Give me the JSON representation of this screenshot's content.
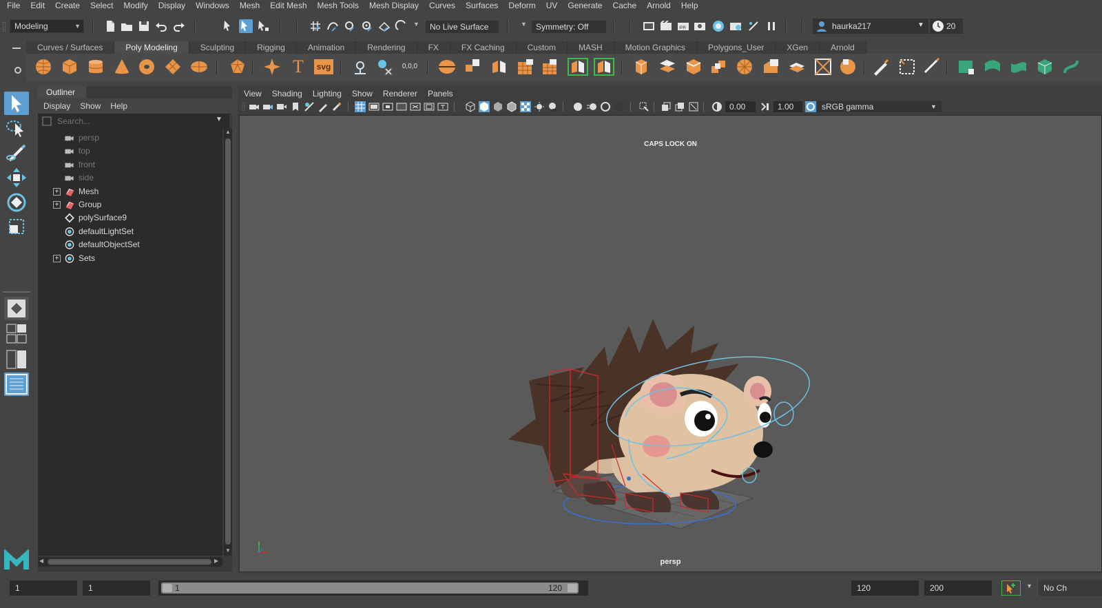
{
  "menubar": [
    "File",
    "Edit",
    "Create",
    "Select",
    "Modify",
    "Display",
    "Windows",
    "Mesh",
    "Edit Mesh",
    "Mesh Tools",
    "Mesh Display",
    "Curves",
    "Surfaces",
    "Deform",
    "UV",
    "Generate",
    "Cache",
    "Arnold",
    "Help"
  ],
  "status": {
    "menuset": "Modeling",
    "live_surface": "No Live Surface",
    "symmetry": "Symmetry: Off",
    "user": "haurka217",
    "clock_value": "20"
  },
  "shelf": {
    "tabs": [
      "Curves / Surfaces",
      "Poly Modeling",
      "Sculpting",
      "Rigging",
      "Animation",
      "Rendering",
      "FX",
      "FX Caching",
      "Custom",
      "MASH",
      "Motion Graphics",
      "Polygons_User",
      "XGen",
      "Arnold"
    ],
    "active_tab": "Poly Modeling",
    "svg_label": "svg",
    "text_label": "T",
    "snow_label": "0,0,0"
  },
  "outliner": {
    "title": "Outliner",
    "menu": [
      "Display",
      "Show",
      "Help"
    ],
    "search_placeholder": "Search...",
    "items": [
      {
        "label": "persp",
        "icon": "camera-icon",
        "expandable": false,
        "dim": true
      },
      {
        "label": "top",
        "icon": "camera-icon",
        "expandable": false,
        "dim": true
      },
      {
        "label": "front",
        "icon": "camera-icon",
        "expandable": false,
        "dim": true
      },
      {
        "label": "side",
        "icon": "camera-icon",
        "expandable": false,
        "dim": true
      },
      {
        "label": "Mesh",
        "icon": "transform-group-icon",
        "expandable": true,
        "dim": false
      },
      {
        "label": "Group",
        "icon": "transform-group-icon",
        "expandable": true,
        "dim": false
      },
      {
        "label": "polySurface9",
        "icon": "transform-node-icon",
        "expandable": false,
        "dim": false
      },
      {
        "label": "defaultLightSet",
        "icon": "set-icon",
        "expandable": false,
        "dim": false
      },
      {
        "label": "defaultObjectSet",
        "icon": "set-icon",
        "expandable": false,
        "dim": false
      },
      {
        "label": "Sets",
        "icon": "set-icon",
        "expandable": true,
        "dim": false
      }
    ]
  },
  "viewport": {
    "menu": [
      "View",
      "Shading",
      "Lighting",
      "Show",
      "Renderer",
      "Panels"
    ],
    "exposure": "0.00",
    "gamma": "1.00",
    "color_space": "sRGB gamma",
    "caps_lock": "CAPS LOCK ON",
    "camera_label": "persp"
  },
  "timeline": {
    "start": "1",
    "playback_start": "1",
    "range_slider_start": "1",
    "range_slider_end": "120",
    "playback_end": "120",
    "end": "200",
    "char_set": "No Ch"
  },
  "colors": {
    "accent_blue": "#5d9fd3",
    "shelf_orange": "#e8954a",
    "shelf_green": "#3aa57a",
    "selection_red": "#d42a2a",
    "manipulator_cyan": "#6cc3e6"
  }
}
